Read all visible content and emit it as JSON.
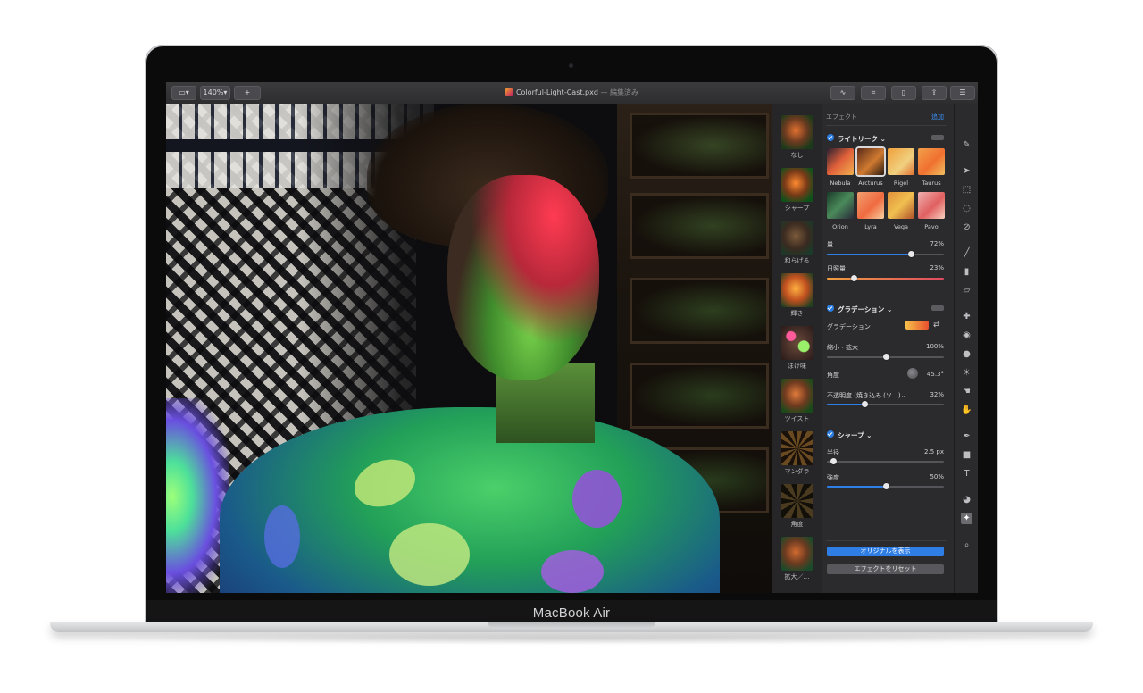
{
  "device": {
    "brand": "MacBook Air"
  },
  "toolbar": {
    "zoom_label": "140%",
    "add_label": "+",
    "file_name": "Colorful-Light-Cast.pxd",
    "separator": " — ",
    "edited_label": "編集済み"
  },
  "presets": [
    {
      "label": "なし"
    },
    {
      "label": "シャープ"
    },
    {
      "label": "和らげる"
    },
    {
      "label": "輝き"
    },
    {
      "label": "ぼけ味"
    },
    {
      "label": "ツイスト"
    },
    {
      "label": "マンダラ"
    },
    {
      "label": "角度"
    },
    {
      "label": "拡大／…"
    }
  ],
  "effects": {
    "header": "エフェクト",
    "add_label": "追加",
    "light_leak": {
      "title": "ライトリーク",
      "swatches": [
        {
          "name": "Nebula",
          "color": "#d9563a"
        },
        {
          "name": "Arcturus",
          "color": "#b8672e"
        },
        {
          "name": "Rigel",
          "color": "#f0a03a"
        },
        {
          "name": "Taurus",
          "color": "#f28a3c"
        },
        {
          "name": "Orion",
          "color": "#3a6a4a"
        },
        {
          "name": "Lyra",
          "color": "#f09060"
        },
        {
          "name": "Vega",
          "color": "#e6a03a"
        },
        {
          "name": "Pavo",
          "color": "#e08080"
        }
      ],
      "selected": "Arcturus",
      "amount_label": "量",
      "amount_value": "72%",
      "amount": 0.72,
      "exposure_label": "日照量",
      "exposure_value": "23%",
      "exposure": 0.23
    },
    "gradient": {
      "title": "グラデーション",
      "gradient_label": "グラデーション",
      "scale_label": "縮小・拡大",
      "scale_value": "100%",
      "scale": 0.5,
      "angle_label": "角度",
      "angle_value": "45.3°",
      "opacity_label": "不透明度 (焼き込み (ソ…)",
      "opacity_value": "32%",
      "opacity": 0.32
    },
    "sharpen": {
      "title": "シャープ",
      "radius_label": "半径",
      "radius_value": "2.5 px",
      "radius": 0.05,
      "strength_label": "強度",
      "strength_value": "50%",
      "strength": 0.5
    },
    "show_original_label": "オリジナルを表示",
    "reset_label": "エフェクトをリセット"
  },
  "colors": {
    "accent": "#2f7ee6",
    "panel": "#2b2b2e"
  },
  "tools": [
    "adjust-icon",
    "arrow-icon",
    "marquee-icon",
    "lasso-icon",
    "quick-select-icon",
    "brush-icon",
    "paint-bucket-icon",
    "eraser-icon",
    "repair-icon",
    "clone-icon",
    "blur-icon",
    "light-icon",
    "smudge-icon",
    "warp-icon",
    "pen-icon",
    "shape-icon",
    "text-icon",
    "color-icon",
    "effects-icon",
    "zoom-icon"
  ]
}
